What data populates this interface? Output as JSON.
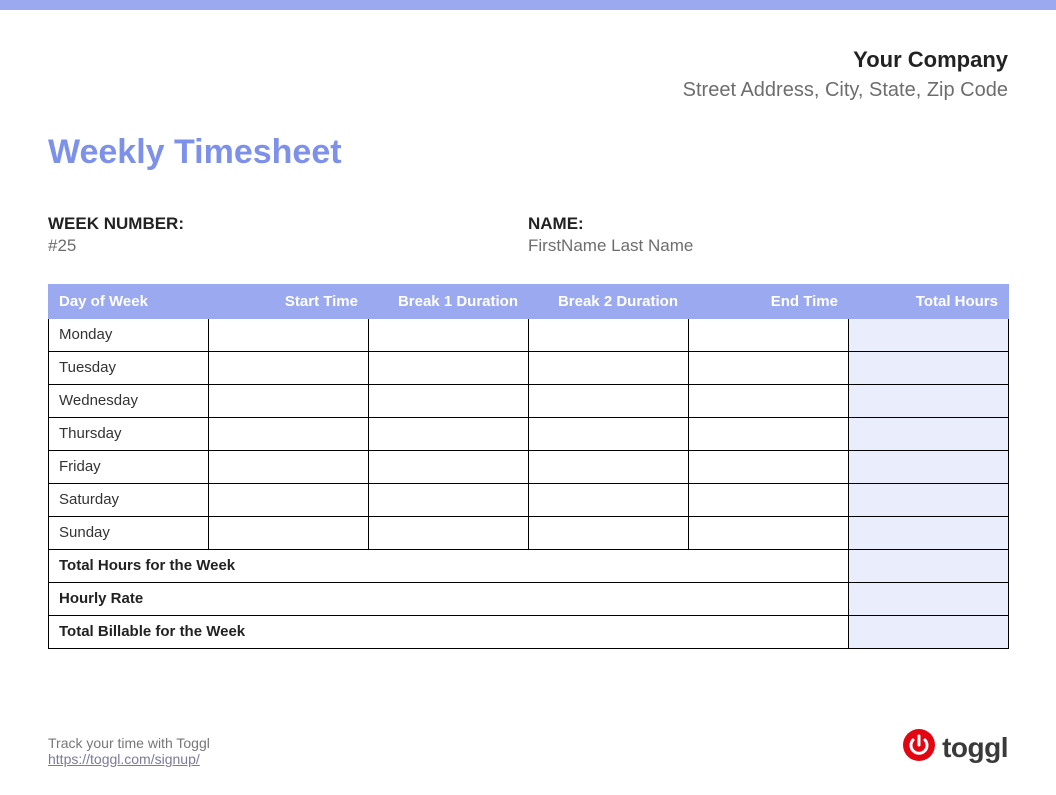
{
  "company": {
    "name": "Your Company",
    "address": "Street Address, City, State, Zip Code"
  },
  "title": "Weekly Timesheet",
  "meta": {
    "week_label": "WEEK NUMBER:",
    "week_value": "#25",
    "name_label": "NAME:",
    "name_value": "FirstName Last Name"
  },
  "columns": {
    "day": "Day of Week",
    "start": "Start Time",
    "break1": "Break 1 Duration",
    "break2": "Break 2 Duration",
    "end": "End Time",
    "total": "Total Hours"
  },
  "days": [
    "Monday",
    "Tuesday",
    "Wednesday",
    "Thursday",
    "Friday",
    "Saturday",
    "Sunday"
  ],
  "rows": [
    {
      "start": "",
      "break1": "",
      "break2": "",
      "end": "",
      "total": ""
    },
    {
      "start": "",
      "break1": "",
      "break2": "",
      "end": "",
      "total": ""
    },
    {
      "start": "",
      "break1": "",
      "break2": "",
      "end": "",
      "total": ""
    },
    {
      "start": "",
      "break1": "",
      "break2": "",
      "end": "",
      "total": ""
    },
    {
      "start": "",
      "break1": "",
      "break2": "",
      "end": "",
      "total": ""
    },
    {
      "start": "",
      "break1": "",
      "break2": "",
      "end": "",
      "total": ""
    },
    {
      "start": "",
      "break1": "",
      "break2": "",
      "end": "",
      "total": ""
    }
  ],
  "summary": {
    "total_hours_label": "Total Hours for the Week",
    "total_hours_value": "",
    "rate_label": "Hourly Rate",
    "rate_value": "",
    "billable_label": "Total Billable for the Week",
    "billable_value": ""
  },
  "footer": {
    "track": "Track your time with Toggl",
    "link": "https://toggl.com/signup/",
    "brand": "toggl"
  },
  "colors": {
    "accent": "#9aa9f0",
    "title": "#7d90ea",
    "logo": "#e20613"
  }
}
